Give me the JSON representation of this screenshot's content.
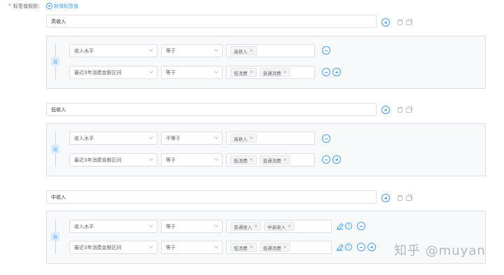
{
  "header": {
    "required_mark": "*",
    "label": "标签值规则：",
    "add_link": "新增标签值"
  },
  "rules": [
    {
      "name": "高收入",
      "conditions": [
        {
          "field": "收入水平",
          "operator": "等于",
          "values": [
            "高收入"
          ]
        },
        {
          "field": "最近3年消费金额区间",
          "operator": "等于",
          "values": [
            "低消费",
            "普通消费"
          ]
        }
      ]
    },
    {
      "name": "低收入",
      "conditions": [
        {
          "field": "收入水平",
          "operator": "不等于",
          "values": [
            "高收入"
          ]
        },
        {
          "field": "最近3年消费金额区间",
          "operator": "等于",
          "values": [
            "低消费",
            "普通消费"
          ]
        }
      ]
    },
    {
      "name": "中收入",
      "conditions": [
        {
          "field": "收入水平",
          "operator": "等于",
          "values": [
            "普通收入",
            "中高收入"
          ]
        },
        {
          "field": "最近3年消费金额区间",
          "operator": "等于",
          "values": [
            "低消费",
            "普通消费"
          ]
        }
      ]
    }
  ],
  "and_label": "且",
  "tag_close": "×",
  "help_glyph": "?",
  "watermark": "知乎 @muyan",
  "colors": {
    "accent": "#409eff",
    "border": "#dcdfe6",
    "required": "#f56c6c",
    "group_bg": "#f8f9fb"
  },
  "icons": [
    "circle-plus-icon",
    "circle-minus-icon",
    "trash-icon",
    "copy-icon",
    "edit-icon",
    "help-icon",
    "chevron-down-icon"
  ]
}
